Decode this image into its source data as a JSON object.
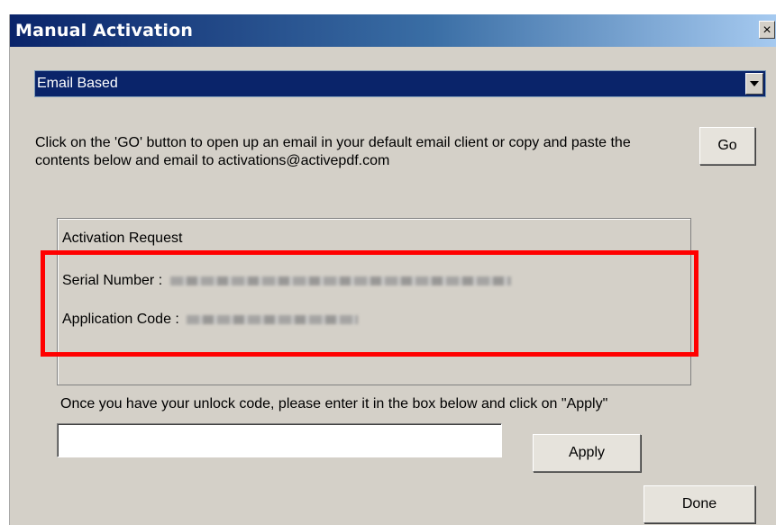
{
  "window": {
    "title": "Manual Activation",
    "close_glyph": "✕"
  },
  "activation_method": {
    "selected": "Email Based"
  },
  "instructions": {
    "text": "Click on the 'GO' button to open up an email in your default email client or copy and paste the contents below and email to activations@activepdf.com"
  },
  "go_button": {
    "label": "Go"
  },
  "activation_request": {
    "title": "Activation Request",
    "serial_label": "Serial Number :",
    "app_code_label": "Application Code :"
  },
  "unlock": {
    "instruction": "Once you have your unlock code, please enter it in the box below and click on \"Apply\"",
    "value": "",
    "placeholder": ""
  },
  "apply_button": {
    "label": "Apply"
  },
  "done_button": {
    "label": "Done"
  },
  "colors": {
    "titlebar_start": "#0a246a",
    "dialog_bg": "#d4d0c8",
    "highlight": "#ff0000"
  }
}
